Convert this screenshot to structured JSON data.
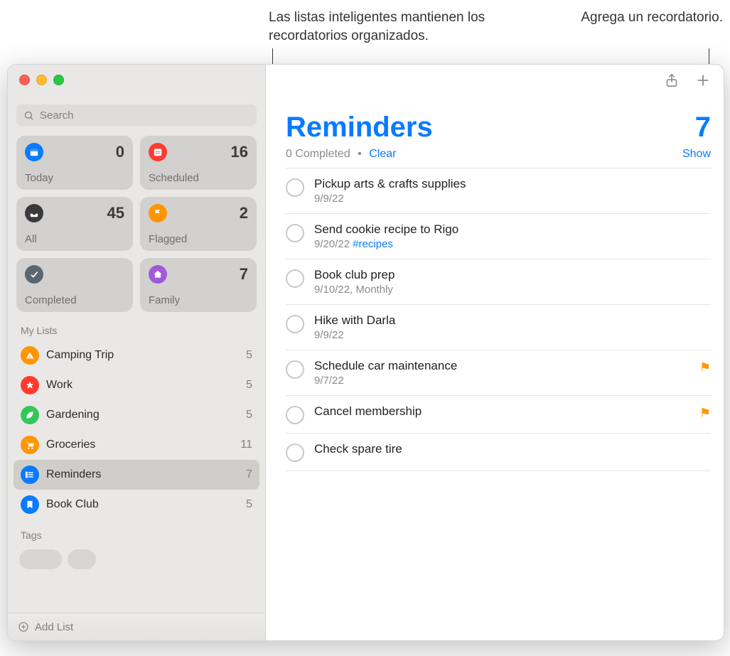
{
  "callouts": {
    "smart_lists": "Las listas inteligentes mantienen los recordatorios organizados.",
    "add_reminder": "Agrega un recordatorio."
  },
  "search": {
    "placeholder": "Search"
  },
  "smart_lists": {
    "today": {
      "label": "Today",
      "count": "0",
      "color": "#0a7aff",
      "icon": "calendar"
    },
    "scheduled": {
      "label": "Scheduled",
      "count": "16",
      "color": "#ff3b30",
      "icon": "calendar-lines"
    },
    "all": {
      "label": "All",
      "count": "45",
      "color": "#3a3a3c",
      "icon": "tray"
    },
    "flagged": {
      "label": "Flagged",
      "count": "2",
      "color": "#ff9500",
      "icon": "flag"
    },
    "completed": {
      "label": "Completed",
      "count": "",
      "color": "#5b6770",
      "icon": "check"
    },
    "family": {
      "label": "Family",
      "count": "7",
      "color": "#a259d9",
      "icon": "house"
    }
  },
  "my_lists_header": "My Lists",
  "my_lists": [
    {
      "name": "Camping Trip",
      "count": "5",
      "color": "#ff9500",
      "icon": "tent"
    },
    {
      "name": "Work",
      "count": "5",
      "color": "#ff3b30",
      "icon": "star"
    },
    {
      "name": "Gardening",
      "count": "5",
      "color": "#34c759",
      "icon": "leaf"
    },
    {
      "name": "Groceries",
      "count": "11",
      "color": "#ff9500",
      "icon": "cart"
    },
    {
      "name": "Reminders",
      "count": "7",
      "color": "#0a7aff",
      "icon": "list",
      "selected": true
    },
    {
      "name": "Book Club",
      "count": "5",
      "color": "#0a7aff",
      "icon": "bookmark"
    }
  ],
  "tags_header": "Tags",
  "add_list_label": "Add List",
  "main": {
    "title": "Reminders",
    "count": "7",
    "completed_text": "0 Completed",
    "clear": "Clear",
    "show": "Show"
  },
  "reminders": [
    {
      "title": "Pickup arts & crafts supplies",
      "sub": "9/9/22"
    },
    {
      "title": "Send cookie recipe to Rigo",
      "sub": "9/20/22 ",
      "tag": "#recipes"
    },
    {
      "title": "Book club prep",
      "sub": "9/10/22, Monthly"
    },
    {
      "title": "Hike with Darla",
      "sub": "9/9/22"
    },
    {
      "title": "Schedule car maintenance",
      "sub": "9/7/22",
      "flagged": true
    },
    {
      "title": "Cancel membership",
      "flagged": true
    },
    {
      "title": "Check spare tire"
    }
  ]
}
